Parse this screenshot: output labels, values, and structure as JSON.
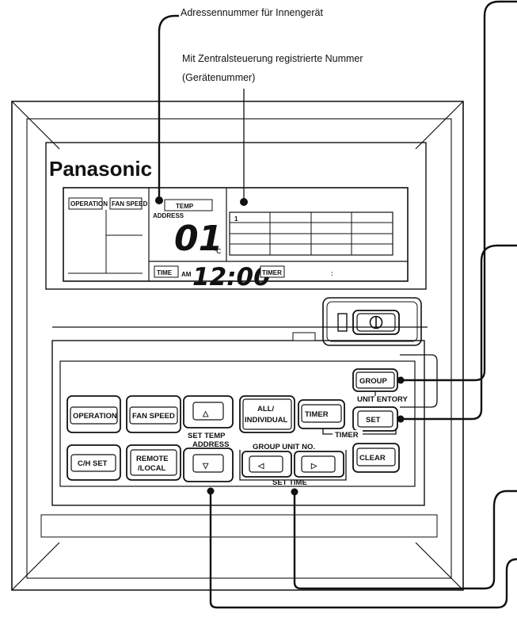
{
  "annotations": {
    "address_number": "Adressennummer für Innengerät",
    "central_number_line1": "Mit Zentralsteuerung registrierte Nummer",
    "central_number_line2": "(Gerätenummer)"
  },
  "brand": "Panasonic",
  "display": {
    "operation": "OPERATION",
    "fan_speed": "FAN SPEED",
    "temp": "TEMP",
    "address": "ADDRESS",
    "big_value": "01",
    "unit": "℃",
    "time": "TIME",
    "am": "AM",
    "clock": "12:00",
    "timer": "TIMER",
    "colon": ":",
    "grid_first_cell": "1"
  },
  "buttons": {
    "operation": "OPERATION",
    "fan_speed": "FAN SPEED",
    "ch_set": "C/H SET",
    "remote_line1": "REMOTE",
    "remote_line2": "/LOCAL",
    "up": "△",
    "down": "▽",
    "set_temp": "SET TEMP",
    "address": "ADDRESS",
    "all_line1": "ALL/",
    "all_line2": "INDIVIDUAL",
    "timer": "TIMER",
    "group": "GROUP",
    "unit_entory": "UNIT ENTORY",
    "set": "SET",
    "timer_bracket": "TIMER",
    "group_unit_no": "GROUP UNIT NO.",
    "left": "◁",
    "right": "▷",
    "set_time": "SET TIME",
    "clear": "CLEAR"
  }
}
